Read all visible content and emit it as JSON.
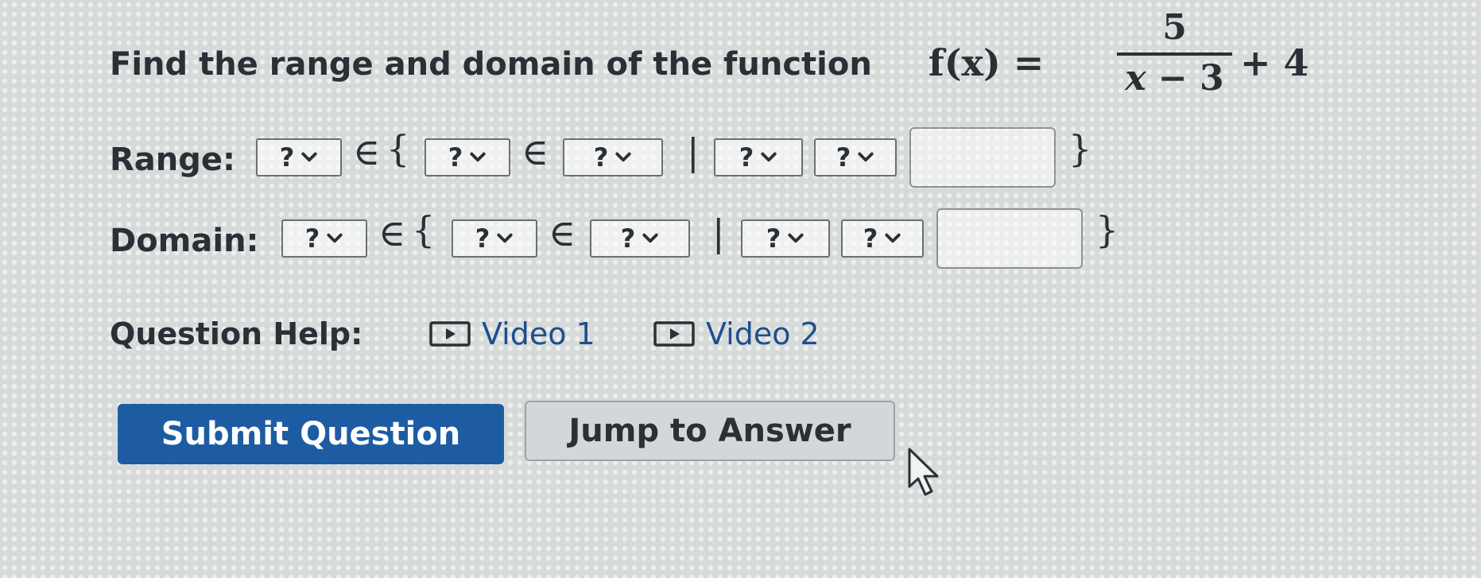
{
  "question": {
    "prefix": "Find the range and domain of the function",
    "fx": "f(x) =",
    "numerator": "5",
    "denominator_var": "x",
    "denominator_rest": "− 3",
    "suffix": "+ 4"
  },
  "symbols": {
    "element_of": "∈",
    "open_brace": "{",
    "close_brace": "}",
    "bar": "|"
  },
  "range": {
    "label": "Range:",
    "selects": [
      "?",
      "?",
      "?",
      "?",
      "?"
    ],
    "input_value": ""
  },
  "domain": {
    "label": "Domain:",
    "selects": [
      "?",
      "?",
      "?",
      "?",
      "?"
    ],
    "input_value": ""
  },
  "help": {
    "label": "Question Help:",
    "videos": [
      "Video 1",
      "Video 2"
    ]
  },
  "buttons": {
    "submit": "Submit Question",
    "jump": "Jump to Answer"
  },
  "icons": {
    "dropdown": "chevron-down-icon",
    "video": "play-video-icon",
    "cursor": "mouse-pointer-icon"
  },
  "colors": {
    "submit_bg": "#1d5ca3",
    "link": "#1f4e8c",
    "text": "#2b2f36"
  }
}
